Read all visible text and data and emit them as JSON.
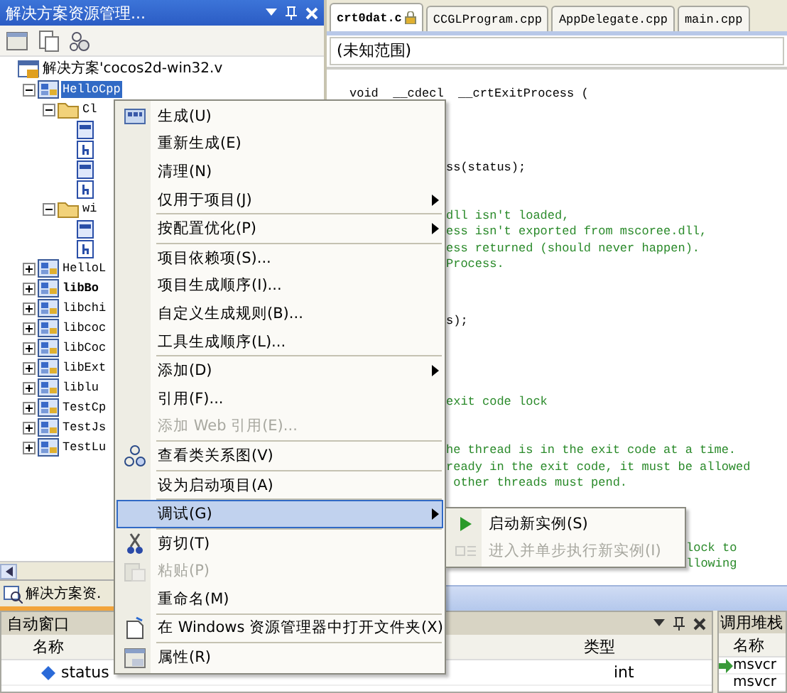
{
  "explorer": {
    "title": "解决方案资源管理...",
    "tab": "解决方案资.",
    "tree": [
      {
        "label": "解决方案'cocos2d-win32.v",
        "kind": "solution",
        "selected": false,
        "startup": false,
        "children": [
          {
            "label": "HelloCpp",
            "kind": "project",
            "expanded": true,
            "selected": true,
            "startup": false,
            "children": [
              {
                "label": "Cl",
                "kind": "folder",
                "expanded": true,
                "selected": false,
                "startup": false,
                "children": [
                  {
                    "kind": "cpp",
                    "selected": false,
                    "startup": false
                  },
                  {
                    "kind": "h",
                    "selected": false,
                    "startup": false
                  },
                  {
                    "kind": "cpp",
                    "selected": false,
                    "startup": false
                  },
                  {
                    "kind": "h",
                    "selected": false,
                    "startup": false
                  }
                ]
              },
              {
                "label": "wi",
                "kind": "folder",
                "expanded": true,
                "selected": false,
                "startup": false,
                "children": [
                  {
                    "kind": "cpp",
                    "selected": false,
                    "startup": false
                  },
                  {
                    "kind": "h",
                    "selected": false,
                    "startup": false
                  }
                ]
              }
            ]
          },
          {
            "label": "HelloL",
            "kind": "project",
            "expanded": false,
            "selected": false,
            "startup": false
          },
          {
            "label": "libBo",
            "kind": "project",
            "expanded": false,
            "selected": false,
            "startup": true
          },
          {
            "label": "libchi",
            "kind": "project",
            "expanded": false,
            "selected": false,
            "startup": false
          },
          {
            "label": "libcoc",
            "kind": "project",
            "expanded": false,
            "selected": false,
            "startup": false
          },
          {
            "label": "libCoc",
            "kind": "project",
            "expanded": false,
            "selected": false,
            "startup": false
          },
          {
            "label": "libExt",
            "kind": "project",
            "expanded": false,
            "selected": false,
            "startup": false
          },
          {
            "label": "liblu",
            "kind": "project",
            "expanded": false,
            "selected": false,
            "startup": false
          },
          {
            "label": "TestCp",
            "kind": "project",
            "expanded": false,
            "selected": false,
            "startup": false
          },
          {
            "label": "TestJs",
            "kind": "project",
            "expanded": false,
            "selected": false,
            "startup": false
          },
          {
            "label": "TestLu",
            "kind": "project",
            "expanded": false,
            "selected": false,
            "startup": false
          }
        ]
      }
    ]
  },
  "editor": {
    "tabs": [
      {
        "label": "crt0dat.c",
        "selected": true,
        "read_only": true
      },
      {
        "label": "CCGLProgram.cpp",
        "selected": false,
        "read_only": false
      },
      {
        "label": "AppDelegate.cpp",
        "selected": false,
        "read_only": false
      },
      {
        "label": "main.cpp",
        "selected": false,
        "read_only": false
      }
    ],
    "scope": "(未知范围)",
    "lines": [
      {
        "kind": "code",
        "text": "void  __cdecl  __crtExitProcess (",
        "clipped": false,
        "after_submenu": false
      },
      {
        "kind": "blank"
      },
      {
        "kind": "blank"
      },
      {
        "kind": "blank"
      },
      {
        "kind": "code",
        "text": "ss(status);",
        "clipped": true,
        "after_submenu": false
      },
      {
        "kind": "blank"
      },
      {
        "kind": "blank"
      },
      {
        "kind": "comment",
        "text": "dll isn't loaded,",
        "clipped": true,
        "after_submenu": false
      },
      {
        "kind": "comment",
        "text": "ess isn't exported from mscoree.dll,",
        "clipped": true,
        "after_submenu": false
      },
      {
        "kind": "comment",
        "text": "ess returned (should never happen).",
        "clipped": true,
        "after_submenu": false
      },
      {
        "kind": "comment",
        "text": "Process.",
        "clipped": true,
        "after_submenu": false
      },
      {
        "kind": "blank"
      },
      {
        "kind": "blank"
      },
      {
        "kind": "code",
        "text": "s);",
        "clipped": true,
        "after_submenu": false
      },
      {
        "kind": "blank"
      },
      {
        "kind": "blank"
      },
      {
        "kind": "blank"
      },
      {
        "kind": "blank"
      },
      {
        "kind": "comment",
        "text": "exit code lock",
        "clipped": true,
        "after_submenu": false
      },
      {
        "kind": "blank"
      },
      {
        "kind": "blank"
      },
      {
        "kind": "comment",
        "text": "he thread is in the exit code at a time.",
        "clipped": true,
        "after_submenu": false
      },
      {
        "kind": "comment",
        "text": "ready in the exit code, it must be allowed",
        "clipped": true,
        "after_submenu": false
      },
      {
        "kind": "comment",
        "text": " other threads must pend.",
        "clipped": true,
        "after_submenu": false
      },
      {
        "kind": "blank"
      },
      {
        "kind": "blank"
      },
      {
        "kind": "blank"
      },
      {
        "kind": "comment",
        "text": "lock to",
        "clipped": true,
        "after_submenu": true
      },
      {
        "kind": "comment",
        "text": "llowing",
        "clipped": true,
        "after_submenu": true
      }
    ]
  },
  "autos": {
    "title": "自动窗口",
    "columns": [
      "名称",
      "类型"
    ],
    "rows": [
      {
        "name": "status",
        "type": "int"
      }
    ]
  },
  "call_stack": {
    "title": "调用堆栈",
    "columns": [
      "名称"
    ],
    "rows": [
      "msvcr",
      "msvcr"
    ]
  },
  "context_menu": [
    {
      "kind": "build",
      "label": "生成(U)",
      "submenu": false,
      "disabled": false,
      "selected": false
    },
    {
      "kind": "plain",
      "label": "重新生成(E)",
      "submenu": false,
      "disabled": false,
      "selected": false
    },
    {
      "kind": "plain",
      "label": "清理(N)",
      "submenu": false,
      "disabled": false,
      "selected": false
    },
    {
      "kind": "plain",
      "label": "仅用于项目(J)",
      "submenu": true,
      "disabled": false,
      "selected": false
    },
    {
      "kind": "separator"
    },
    {
      "kind": "plain",
      "label": "按配置优化(P)",
      "submenu": true,
      "disabled": false,
      "selected": false
    },
    {
      "kind": "separator"
    },
    {
      "kind": "plain",
      "label": "项目依赖项(S)...",
      "submenu": false,
      "disabled": false,
      "selected": false
    },
    {
      "kind": "plain",
      "label": "项目生成顺序(I)...",
      "submenu": false,
      "disabled": false,
      "selected": false
    },
    {
      "kind": "plain",
      "label": "自定义生成规则(B)...",
      "submenu": false,
      "disabled": false,
      "selected": false
    },
    {
      "kind": "plain",
      "label": "工具生成顺序(L)...",
      "submenu": false,
      "disabled": false,
      "selected": false
    },
    {
      "kind": "separator"
    },
    {
      "kind": "plain",
      "label": "添加(D)",
      "submenu": true,
      "disabled": false,
      "selected": false
    },
    {
      "kind": "plain",
      "label": "引用(F)...",
      "submenu": false,
      "disabled": false,
      "selected": false
    },
    {
      "kind": "plain",
      "label": "添加 Web 引用(E)...",
      "submenu": false,
      "disabled": true,
      "selected": false
    },
    {
      "kind": "separator"
    },
    {
      "kind": "classview",
      "label": "查看类关系图(V)",
      "submenu": false,
      "disabled": false,
      "selected": false
    },
    {
      "kind": "separator"
    },
    {
      "kind": "plain",
      "label": "设为启动项目(A)",
      "submenu": false,
      "disabled": false,
      "selected": false
    },
    {
      "kind": "separator"
    },
    {
      "kind": "plain",
      "label": "调试(G)",
      "submenu": true,
      "disabled": false,
      "selected": true
    },
    {
      "kind": "separator"
    },
    {
      "kind": "cut",
      "label": "剪切(T)",
      "submenu": false,
      "disabled": false,
      "selected": false
    },
    {
      "kind": "paste",
      "label": "粘贴(P)",
      "submenu": false,
      "disabled": true,
      "selected": false
    },
    {
      "kind": "plain",
      "label": "重命名(M)",
      "submenu": false,
      "disabled": false,
      "selected": false
    },
    {
      "kind": "separator"
    },
    {
      "kind": "explorer",
      "label": "在 Windows 资源管理器中打开文件夹(X)",
      "submenu": false,
      "disabled": false,
      "selected": false
    },
    {
      "kind": "separator"
    },
    {
      "kind": "properties",
      "label": "属性(R)",
      "submenu": false,
      "disabled": false,
      "selected": false
    }
  ],
  "submenu": [
    {
      "kind": "play",
      "label": "启动新实例(S)",
      "disabled": false
    },
    {
      "kind": "step",
      "label": "进入并单步执行新实例(I)",
      "disabled": true
    }
  ]
}
